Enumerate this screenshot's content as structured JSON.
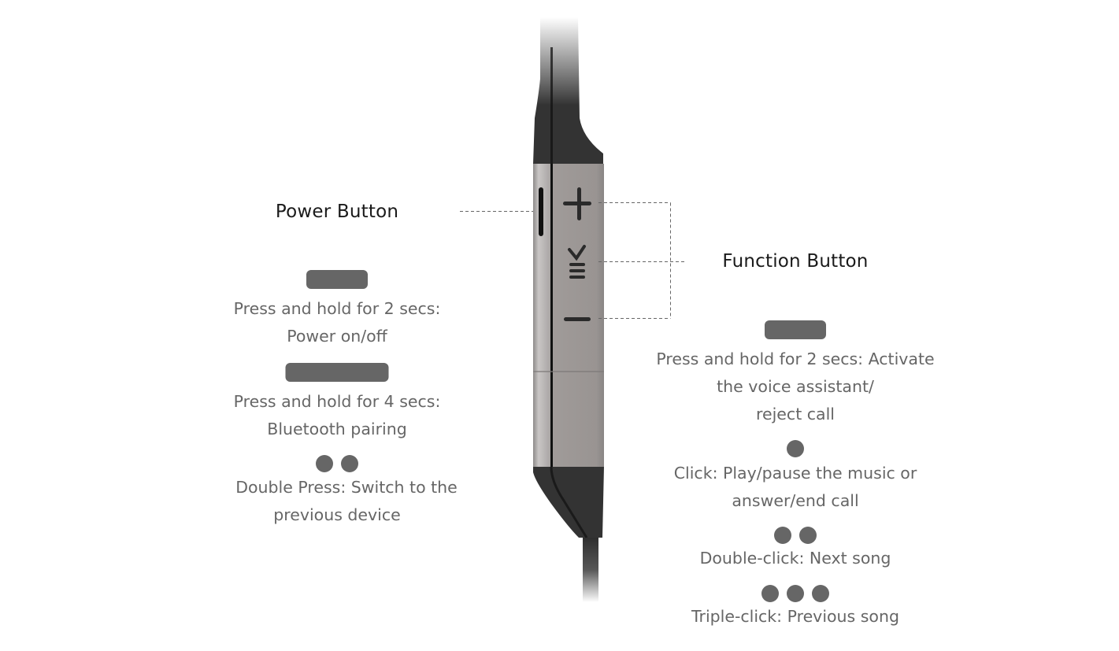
{
  "colors": {
    "indicator": "#666666",
    "title_text": "#1a1a1a",
    "desc_text": "#666666",
    "device_body": "#9a9593",
    "device_cap": "#333333",
    "connector_line": "#666666"
  },
  "power_button": {
    "title": "Power Button",
    "actions": [
      {
        "indicator": "short-hold",
        "line1": "Press and hold for 2 secs:",
        "line2": "Power on/off"
      },
      {
        "indicator": "long-hold",
        "line1": "Press and hold for 4 secs:",
        "line2": "Bluetooth pairing"
      },
      {
        "indicator": "double-press",
        "line1": "Double Press: Switch to the",
        "line2": "previous device"
      }
    ]
  },
  "function_button": {
    "title": "Function Button",
    "actions": [
      {
        "indicator": "short-hold",
        "line1": "Press and hold for 2 secs: Activate",
        "line2": "the voice assistant/",
        "line3": "reject call"
      },
      {
        "indicator": "single-click",
        "line1": "Click: Play/pause the music or",
        "line2": "answer/end call"
      },
      {
        "indicator": "double-click",
        "line1": "Double-click: Next song"
      },
      {
        "indicator": "triple-click",
        "line1": "Triple-click: Previous song"
      }
    ]
  },
  "device_buttons": {
    "volume_up": "+",
    "function": "multi-function",
    "volume_down": "−"
  }
}
